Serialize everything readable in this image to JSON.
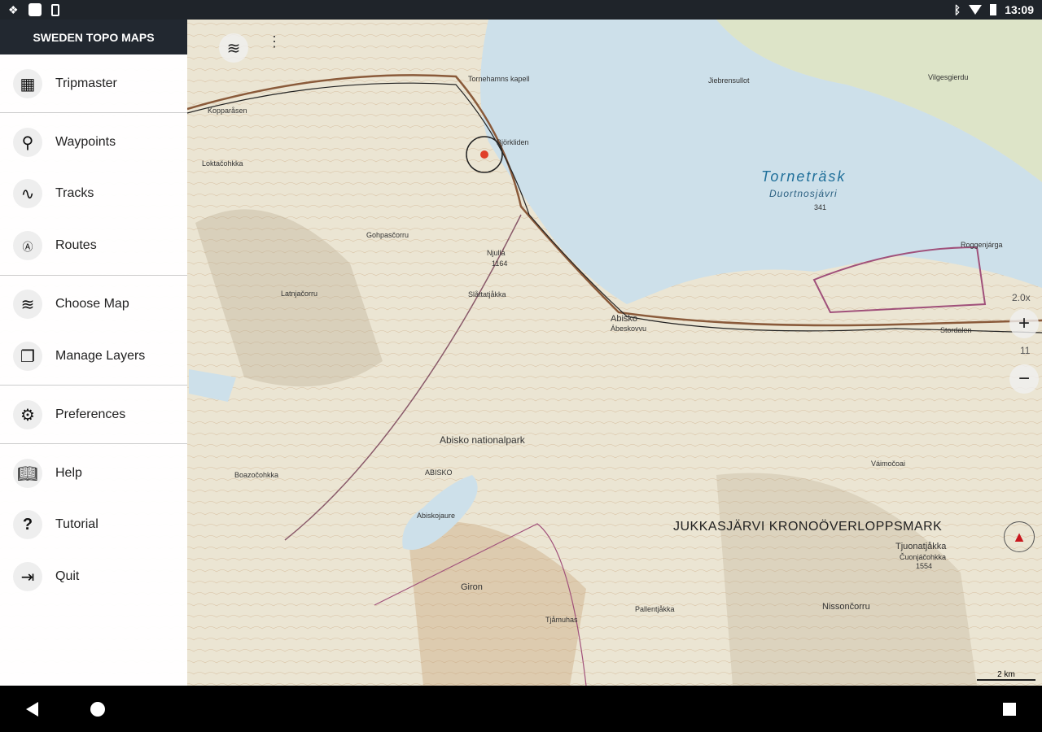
{
  "status": {
    "time": "13:09",
    "icons": [
      "dropbox-icon",
      "app-icon",
      "download-icon",
      "bluetooth-icon",
      "wifi-icon",
      "battery-icon"
    ]
  },
  "drawer": {
    "title": "SWEDEN TOPO MAPS",
    "items": [
      {
        "label": "Tripmaster",
        "icon": "grid-icon"
      },
      {
        "label": "Waypoints",
        "icon": "pin-icon"
      },
      {
        "label": "Tracks",
        "icon": "track-icon"
      },
      {
        "label": "Routes",
        "icon": "route-icon"
      },
      {
        "label": "Choose Map",
        "icon": "layers-icon"
      },
      {
        "label": "Manage Layers",
        "icon": "manage-layers-icon"
      },
      {
        "label": "Preferences",
        "icon": "gear-icon"
      },
      {
        "label": "Help",
        "icon": "book-icon"
      },
      {
        "label": "Tutorial",
        "icon": "question-icon"
      },
      {
        "label": "Quit",
        "icon": "exit-icon"
      }
    ]
  },
  "map": {
    "zoom_factor": "2.0x",
    "zoom_level": "11",
    "scale": "2 km",
    "labels": {
      "lake": "Torneträsk",
      "lake_sami": "Duortnosjávri",
      "lake_elev": "341",
      "park": "Abisko nationalpark",
      "region": "JUKKASJÄRVI KRONOÖVERLOPPSMARK",
      "abisko": "Abisko",
      "abisko_sami": "Ábeskovvu",
      "bjorkliden": "Björkliden",
      "njulla": "Njullá",
      "njulla_elev": "1164",
      "giron": "Giron",
      "nissoncorru": "Nissončorru",
      "tjuonatjakka": "Tjuonatjåkka",
      "tjuonatjakka_sami": "Čuonjáčohkka",
      "tjuonatjakka_elev": "1554",
      "abiskojaure": "Abiskojaure",
      "abisko_area": "ABISKO",
      "gohpascorru": "Gohpasčorru",
      "latnjacorru": "Latnjačorru",
      "boazocohkka": "Boazočohkka",
      "vaimocoai": "Váimočoai",
      "pallentjakka": "Pallentjåkka",
      "stordalen": "Stordalen",
      "tornehamn": "Tornehamns kapell",
      "kopparasen": "Kopparåsen",
      "loktacohkka": "Loktačohkka",
      "jiebrensullot": "Jiebrensullot",
      "vilgesgierdu": "Vilgesgierdu",
      "roggenjarga": "Roggenjárga",
      "tjamuhas": "Tjåmuhas",
      "slattatjakka": "Slåttatjåkka"
    }
  },
  "colors": {
    "lake": "#cde0ea",
    "land": "#ebe5d3",
    "header": "#222830",
    "compass": "#c8161d"
  }
}
